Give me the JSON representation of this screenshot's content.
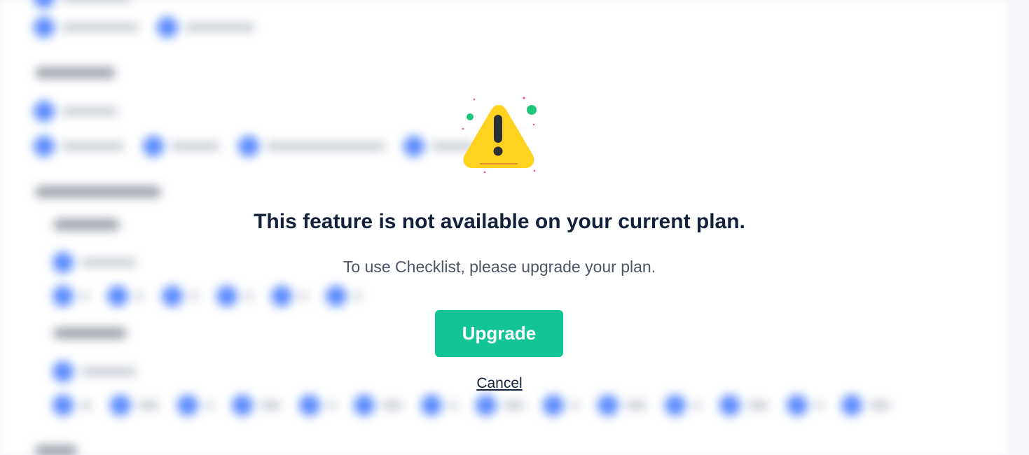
{
  "modal": {
    "title": "This feature is not available on your current plan.",
    "message": "To use Checklist, please upgrade your plan.",
    "upgrade_label": "Upgrade",
    "cancel_label": "Cancel",
    "icon": "warning-triangle-icon"
  },
  "colors": {
    "accent": "#13c497",
    "warning": "#ffd21f",
    "title_text": "#13213a",
    "background_chip": "#5b8bff"
  }
}
